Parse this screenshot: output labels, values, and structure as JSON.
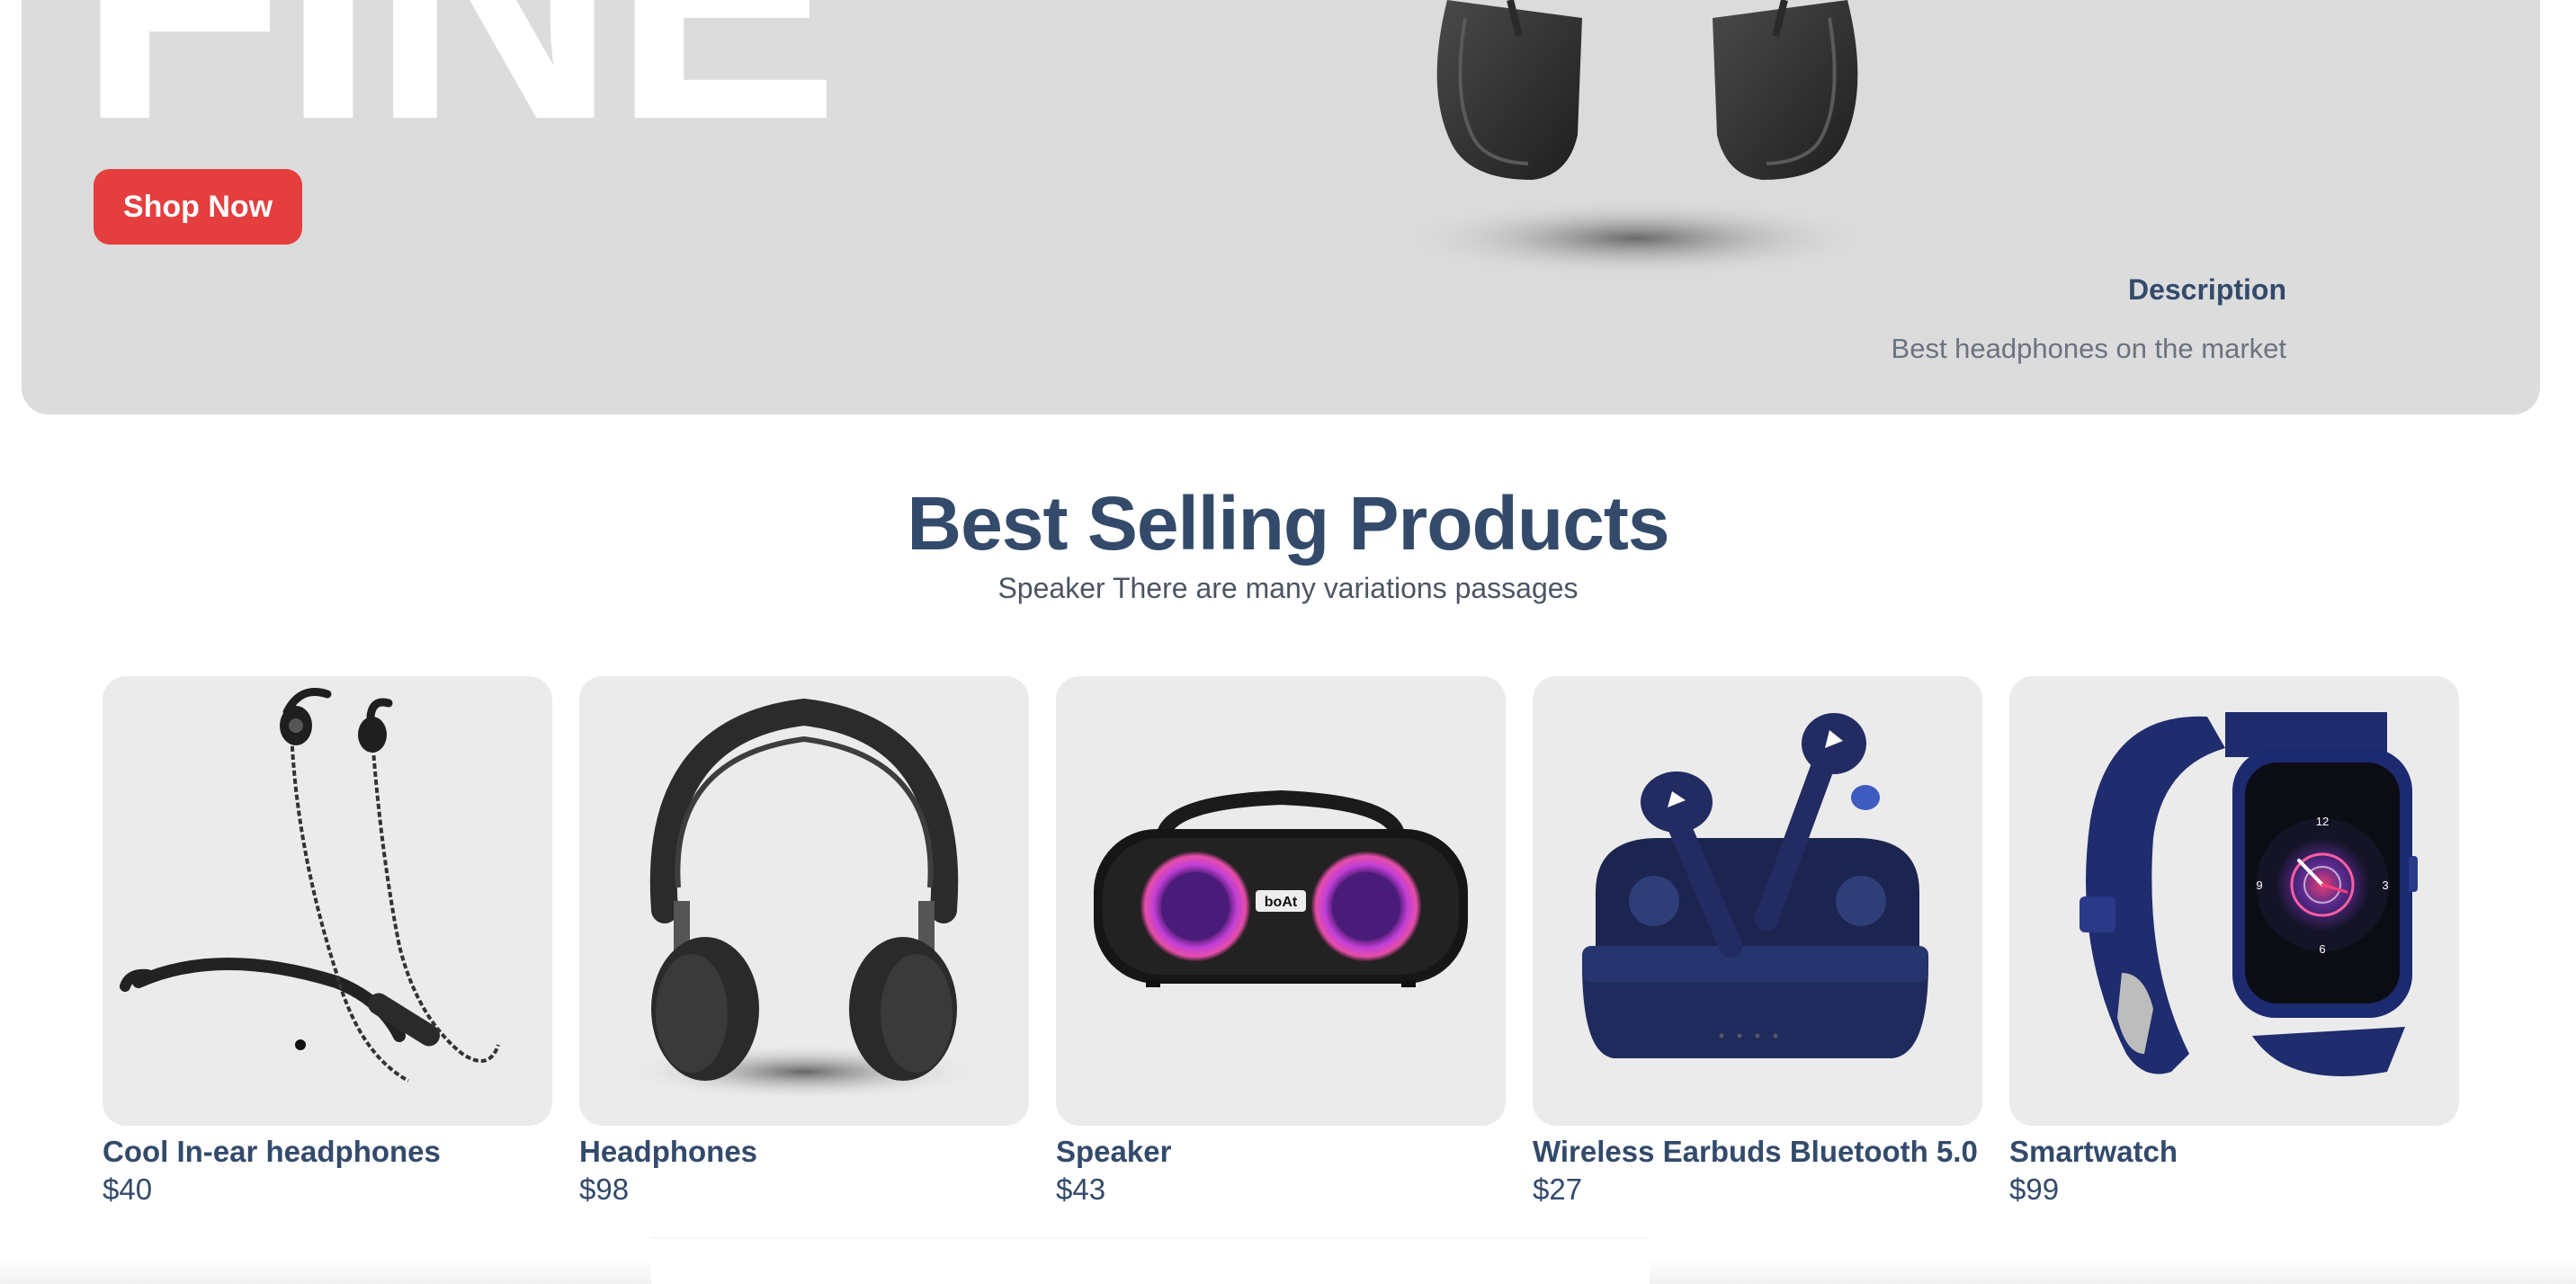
{
  "hero": {
    "headline_fragment": "FINE",
    "cta_label": "Shop Now",
    "description_title": "Description",
    "description_text": "Best headphones on the market",
    "image_icon": "headphones-image"
  },
  "section": {
    "title": "Best Selling Products",
    "subtitle": "Speaker There are many variations passages"
  },
  "products": [
    {
      "name": "Cool In-ear headphones",
      "price": "$40",
      "image_icon": "neckband-earphones-image"
    },
    {
      "name": "Headphones",
      "price": "$98",
      "image_icon": "headphones-image"
    },
    {
      "name": "Speaker",
      "price": "$43",
      "image_icon": "speaker-image"
    },
    {
      "name": "Wireless Earbuds Bluetooth 5.0",
      "price": "$27",
      "image_icon": "earbuds-image"
    },
    {
      "name": "Smartwatch",
      "price": "$99",
      "image_icon": "smartwatch-image"
    }
  ],
  "colors": {
    "accent": "#e53e3e",
    "heading": "#334a6b",
    "hero_bg": "#dcdcdc",
    "card_bg": "#ebebeb"
  }
}
